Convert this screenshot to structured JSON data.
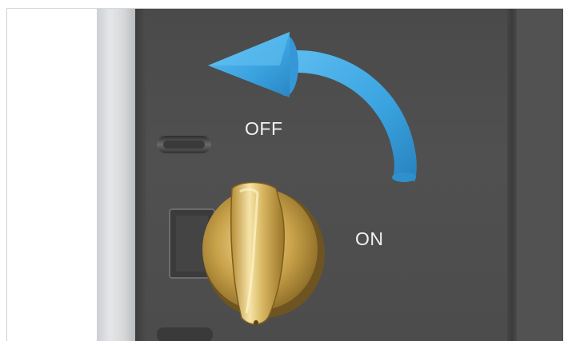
{
  "labels": {
    "off": "OFF",
    "on": "ON"
  },
  "icons": {
    "rotate_arrow": "curved-arrow-counterclockwise-icon",
    "knob": "rotary-switch-knob"
  },
  "colors": {
    "arrow": "#3aa3e0",
    "knob_gold": "#c9a24a",
    "panel": "#4d4d4d",
    "text": "#f2f2f2"
  },
  "switch_state": "ON"
}
